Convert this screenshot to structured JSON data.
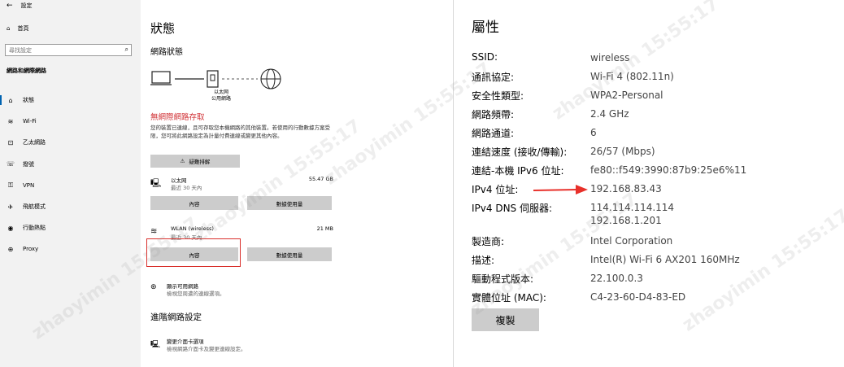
{
  "sidebar": {
    "window_title": "設定",
    "home": "首頁",
    "search_placeholder": "尋找設定",
    "section": "網路和網際網路",
    "items": [
      {
        "label": "狀態",
        "icon": "home-icon"
      },
      {
        "label": "Wi-Fi",
        "icon": "wifi-icon"
      },
      {
        "label": "乙太網路",
        "icon": "ethernet-icon"
      },
      {
        "label": "撥號",
        "icon": "dialup-icon"
      },
      {
        "label": "VPN",
        "icon": "vpn-icon"
      },
      {
        "label": "飛航模式",
        "icon": "airplane-icon"
      },
      {
        "label": "行動熱點",
        "icon": "hotspot-icon"
      },
      {
        "label": "Proxy",
        "icon": "globe-icon"
      }
    ]
  },
  "status": {
    "title": "狀態",
    "network_status": "網路狀態",
    "ethernet_label_1": "以太网",
    "ethernet_label_2": "公用網路",
    "alert": "無網際網路存取",
    "description": "您的裝置已連線，且可存取您本機網路的其他裝置。若使用的行動數據方案受限，您可將此網路設定為計量付費連線或變更其他內容。",
    "troubleshoot": "疑難排解",
    "ethernet": {
      "name": "以太网",
      "sub": "最近 30 天內",
      "size": "55.47 GB",
      "properties": "內容",
      "data_usage": "數據使用量"
    },
    "wlan": {
      "name": "WLAN (wireless)",
      "sub": "最近 30 天內",
      "size": "21 MB",
      "properties": "內容",
      "data_usage": "數據使用量"
    },
    "show_networks": {
      "name": "顯示可用網路",
      "desc": "檢視您周遭的連線選項。"
    },
    "advanced_title": "進階網路設定",
    "adapter_options": {
      "name": "變更介面卡選項",
      "desc": "檢視網路介面卡及變更連線設定。"
    }
  },
  "properties": {
    "title": "屬性",
    "rows": [
      {
        "key": "SSID:",
        "value": "wireless"
      },
      {
        "key": "通訊協定:",
        "value": "Wi-Fi 4 (802.11n)"
      },
      {
        "key": "安全性類型:",
        "value": "WPA2-Personal"
      },
      {
        "key": "網路頻帶:",
        "value": "2.4 GHz"
      },
      {
        "key": "網路通道:",
        "value": "6"
      },
      {
        "key": "連結速度 (接收/傳輸):",
        "value": "26/57 (Mbps)"
      },
      {
        "key": "連結-本機 IPv6 位址:",
        "value": "fe80::f549:3990:87b9:25e6%11"
      },
      {
        "key": "IPv4 位址:",
        "value": "192.168.83.43"
      },
      {
        "key": "IPv4 DNS 伺服器:",
        "value": "114.114.114.114",
        "value2": "192.168.1.201"
      },
      {
        "key": "製造商:",
        "value": "Intel Corporation"
      },
      {
        "key": "描述:",
        "value": "Intel(R) Wi-Fi 6 AX201 160MHz"
      },
      {
        "key": "驅動程式版本:",
        "value": "22.100.0.3"
      },
      {
        "key": "實體位址 (MAC):",
        "value": "C4-23-60-D4-83-ED"
      }
    ],
    "copy": "複製"
  },
  "colors": {
    "accent": "#0063b1",
    "alert": "#d13438",
    "arrow": "#e8302a",
    "button": "#cccccc"
  },
  "watermark": [
    "zhaoyimin 15:55:17",
    "zhaoyimin 15:55:17",
    "zhaoyimin 15:55:17",
    "zhaoyimin 15:55:17",
    "zhaoyimin 15:55:17",
    "zhaoyimin 15:55:17"
  ]
}
